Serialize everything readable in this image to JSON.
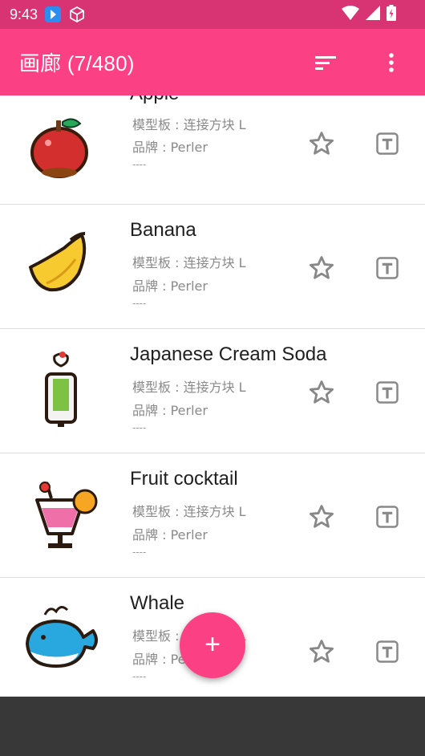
{
  "status_bar": {
    "time": "9:43"
  },
  "app_bar": {
    "title": "画廊 (7/480)"
  },
  "items": [
    {
      "name": "Apple",
      "template": "模型板 : 连接方块 L",
      "brand": "品牌 : Perler",
      "note": "----"
    },
    {
      "name": "Banana",
      "template": "模型板 : 连接方块 L",
      "brand": "品牌 : Perler",
      "note": "----"
    },
    {
      "name": "Japanese Cream Soda",
      "template": "模型板 : 连接方块 L",
      "brand": "品牌 : Perler",
      "note": "----"
    },
    {
      "name": "Fruit cocktail",
      "template": "模型板 : 连接方块 L",
      "brand": "品牌 : Perler",
      "note": "----"
    },
    {
      "name": "Whale",
      "template": "模型板 : 连接方块 L",
      "brand": "品牌 : Perler",
      "note": "----"
    }
  ],
  "fab": {
    "label": "+"
  },
  "colors": {
    "primary": "#fb4184",
    "status_bar": "#d83373",
    "nav_bar": "#383838"
  }
}
